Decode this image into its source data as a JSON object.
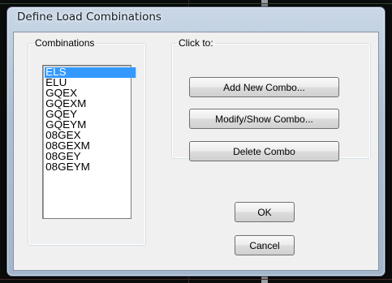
{
  "dialog": {
    "title": "Define Load Combinations"
  },
  "combinations": {
    "label": "Combinations",
    "items": [
      {
        "label": "ELS",
        "selected": true
      },
      {
        "label": "ELU",
        "selected": false
      },
      {
        "label": "GQEX",
        "selected": false
      },
      {
        "label": "GQEXM",
        "selected": false
      },
      {
        "label": "GQEY",
        "selected": false
      },
      {
        "label": "GQEYM",
        "selected": false
      },
      {
        "label": "08GEX",
        "selected": false
      },
      {
        "label": "08GEXM",
        "selected": false
      },
      {
        "label": "08GEY",
        "selected": false
      },
      {
        "label": "08GEYM",
        "selected": false
      }
    ]
  },
  "click_to": {
    "label": "Click to:",
    "add_label": "Add New Combo...",
    "modify_label": "Modify/Show Combo...",
    "delete_label": "Delete Combo"
  },
  "buttons": {
    "ok_label": "OK",
    "cancel_label": "Cancel"
  },
  "colors": {
    "selection": "#3399ff",
    "dialog_bg": "#f0f0f0"
  }
}
